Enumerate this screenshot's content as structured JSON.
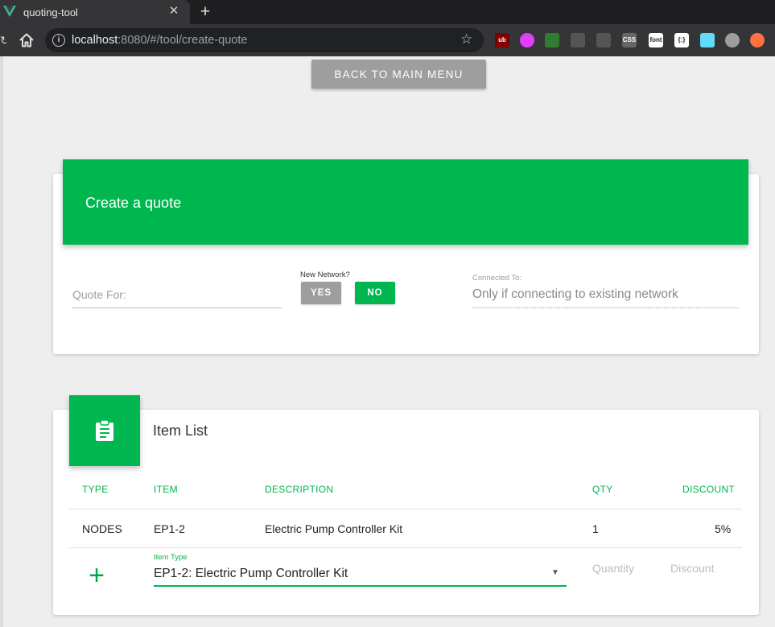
{
  "browser": {
    "tab_title": "quoting-tool",
    "tab_close": "✕",
    "new_tab": "+",
    "url_host": "localhost",
    "url_path": ":8080/#/tool/create-quote",
    "extensions": [
      {
        "name": "ublock",
        "color": "#800000",
        "label": "ub"
      },
      {
        "name": "power",
        "color": "#e040fb",
        "label": ""
      },
      {
        "name": "spy",
        "color": "#2e7d32",
        "label": ""
      },
      {
        "name": "sync",
        "color": "#555555",
        "label": ""
      },
      {
        "name": "clipboard",
        "color": "#555555",
        "label": ""
      },
      {
        "name": "css",
        "color": "#666666",
        "label": "CSS"
      },
      {
        "name": "font",
        "color": "#ffffff",
        "label": "font"
      },
      {
        "name": "json",
        "color": "#ffffff",
        "label": "{:}"
      },
      {
        "name": "react",
        "color": "#61dafb",
        "label": ""
      },
      {
        "name": "chat",
        "color": "#9e9e9e",
        "label": ""
      },
      {
        "name": "profile",
        "color": "#ff7043",
        "label": ""
      }
    ]
  },
  "page": {
    "back_button": "BACK TO MAIN MENU"
  },
  "quote_card": {
    "title": "Create a quote",
    "quote_for_placeholder": "Quote For:",
    "new_network_label": "New Network?",
    "yes_label": "YES",
    "no_label": "NO",
    "connected_label": "Connected To:",
    "connected_placeholder": "Only if connecting to existing network"
  },
  "item_list": {
    "title": "Item List",
    "columns": [
      "TYPE",
      "ITEM",
      "DESCRIPTION",
      "QTY",
      "DISCOUNT"
    ],
    "rows": [
      {
        "type": "NODES",
        "item": "EP1-2",
        "description": "Electric Pump Controller Kit",
        "qty": "1",
        "discount": "5%"
      }
    ],
    "new_row": {
      "add_symbol": "+",
      "item_type_label": "Item Type",
      "item_type_value": "EP1-2: Electric Pump Controller Kit",
      "quantity_placeholder": "Quantity",
      "discount_placeholder": "Discount"
    }
  },
  "colors": {
    "accent": "#00b74f",
    "grey_button": "#9e9e9e",
    "background": "#eeeeee"
  }
}
